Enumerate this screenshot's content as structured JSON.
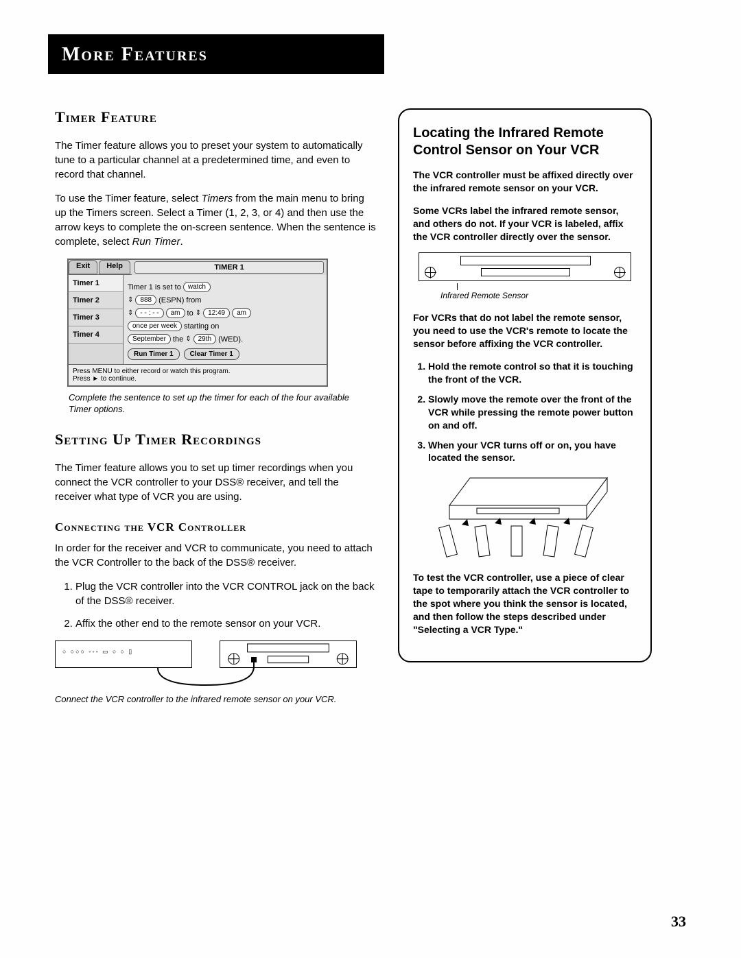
{
  "header": "More Features",
  "left": {
    "h_timer": "Timer Feature",
    "p1": "The Timer feature allows you to preset your system to automatically tune to a particular channel at a predetermined time, and even to record that channel.",
    "p2a": "To use the Timer feature, select ",
    "p2i1": "Timers",
    "p2b": " from the main menu to bring up the Timers screen. Select a Timer (1, 2, 3, or 4) and then use the arrow keys to complete the on-screen sentence. When the sentence is complete, select ",
    "p2i2": "Run Timer",
    "p2c": ".",
    "caption1": "Complete the sentence to set up the timer for each of the four available Timer options.",
    "h_setting": "Setting Up Timer Recordings",
    "p3": "The Timer feature allows you to set up timer recordings when you connect the VCR controller to your DSS® receiver, and tell the receiver what type of VCR you are using.",
    "h_connect": "Connecting the VCR Controller",
    "p4": "In order for the receiver and VCR to communicate, you need to attach the VCR Controller to the back of the DSS® receiver.",
    "step1": "Plug the VCR controller into the VCR CONTROL jack on the back of the DSS® receiver.",
    "step2": "Affix the other end to the remote sensor on your VCR.",
    "caption2": "Connect the VCR controller to the infrared remote sensor on your VCR."
  },
  "timer_ui": {
    "tab_exit": "Exit",
    "tab_help": "Help",
    "title": "TIMER 1",
    "side": [
      "Timer 1",
      "Timer 2",
      "Timer 3",
      "Timer 4"
    ],
    "line1a": "Timer 1 is set to",
    "line1b": "watch",
    "channel_num": "888",
    "channel_name": "(ESPN) from",
    "time_from": "- - : - -",
    "ampm1": "am",
    "to": "to",
    "time_to": "12:49",
    "ampm2": "am",
    "freq": "once per week",
    "starting": "starting on",
    "month": "September",
    "the": "the",
    "day": "29th",
    "dow": "(WED).",
    "btn_run": "Run Timer 1",
    "btn_clear": "Clear Timer 1",
    "footer1": "Press MENU to either record or watch this program.",
    "footer2": "Press ► to continue."
  },
  "sidebar": {
    "h": "Locating the Infrared Remote Control Sensor on Your VCR",
    "p1": "The VCR controller must be affixed directly over the infrared remote sensor on your VCR.",
    "p2": "Some VCRs label the infrared remote sensor, and others do not. If your VCR is labeled, affix the VCR controller directly over the sensor.",
    "fig_label": "Infrared Remote Sensor",
    "p3": "For VCRs that do not label the remote sensor, you need to use the VCR's remote to locate the sensor before affixing the VCR controller.",
    "s1": "Hold the remote control so that it is touching the front of the VCR.",
    "s2": "Slowly move the remote over the front of the VCR while pressing the remote power button on and off.",
    "s3": "When your VCR turns off or on, you have located the sensor.",
    "p4": "To test the VCR controller, use a piece of clear tape to temporarily attach the VCR controller to the spot where you think the sensor is located, and then follow the steps described under \"Selecting a VCR Type.\""
  },
  "page_number": "33"
}
